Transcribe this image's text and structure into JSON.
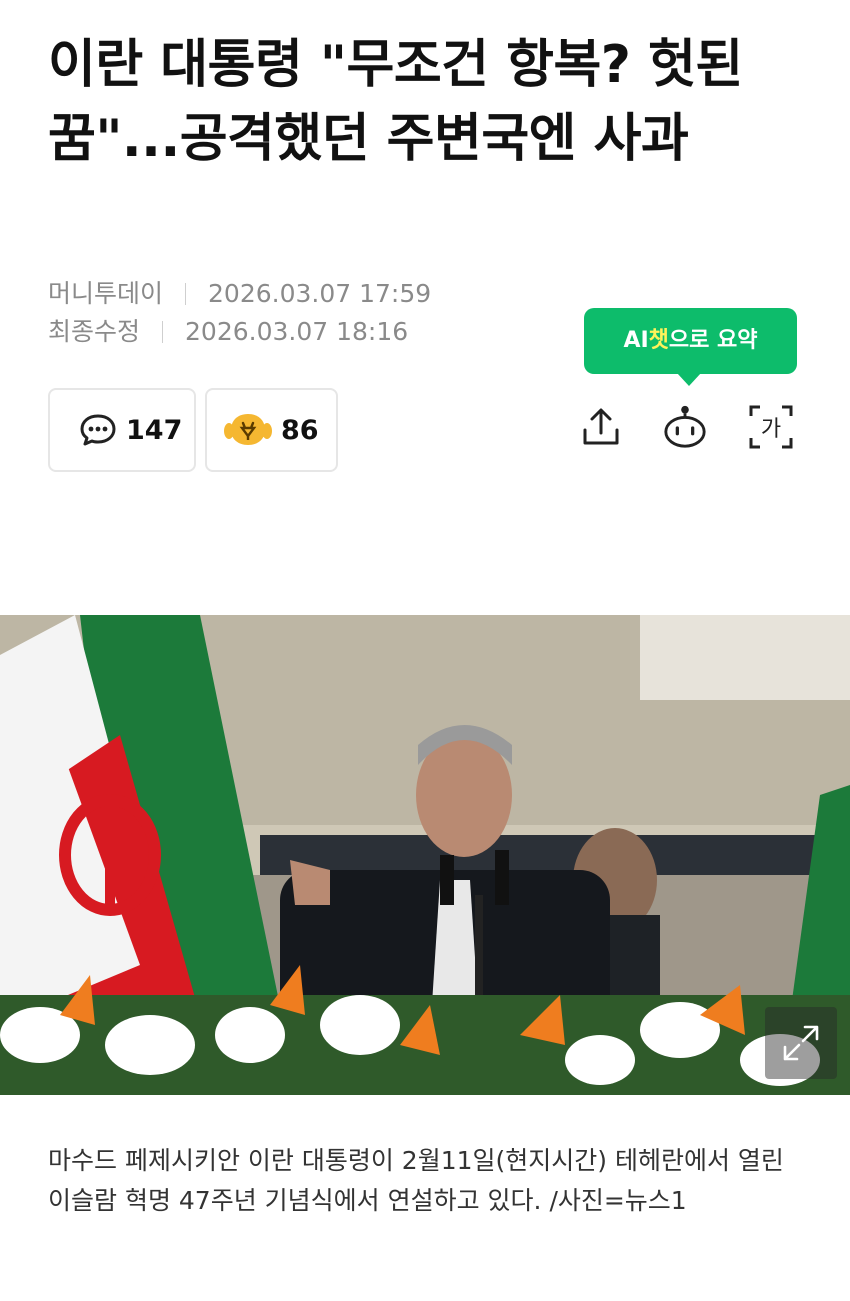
{
  "article": {
    "headline": "이란 대통령 \"무조건 항복? 헛된 꿈\"...공격했던 주변국엔 사과",
    "source": "머니투데이",
    "published": "2026.03.07 17:59",
    "updated_label": "최종수정",
    "updated": "2026.03.07 18:16",
    "caption": "마수드 페제시키안 이란 대통령이 2월11일(현지시간) 테헤란에서 열린 이슬람 혁명 47주년 기념식에서 연설하고 있다. /사진=뉴스1"
  },
  "ai_summary": {
    "prefix": "AI",
    "highlight": "챗",
    "suffix": "으로 요약"
  },
  "reactions": {
    "comments_count": "147",
    "reaction_count": "86"
  },
  "toolbar": {
    "share_icon": "share-icon",
    "bot_icon": "ai-bot-icon",
    "font_icon": "font-size-icon",
    "font_glyph": "가"
  },
  "colors": {
    "ai_green": "#0dbc6b",
    "ai_highlight": "#fff35a",
    "meta_gray": "#8a8a8a",
    "reaction_yellow": "#f5b731"
  }
}
